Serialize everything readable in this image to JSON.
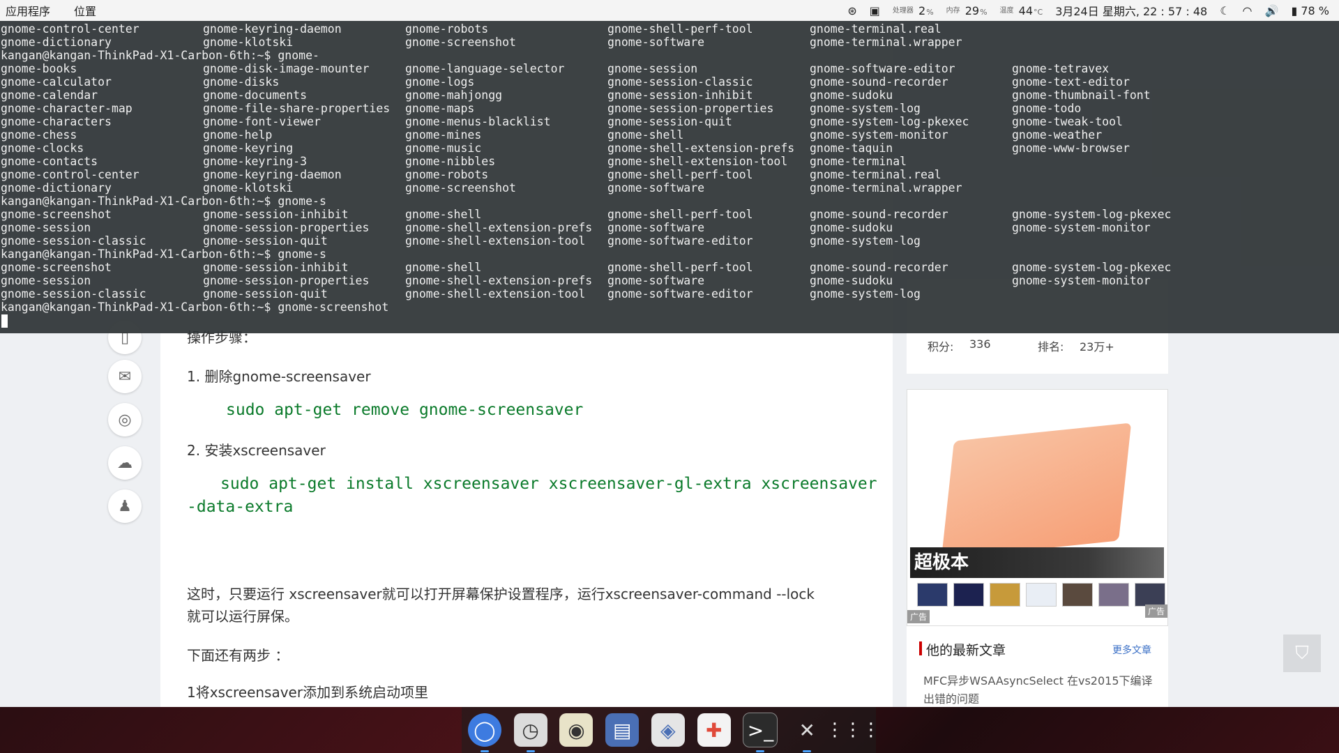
{
  "topbar": {
    "apps_label": "应用程序",
    "places_label": "位置",
    "cpu_label": "处理器",
    "cpu_value": "2",
    "cpu_unit": "%",
    "mem_label": "内存",
    "mem_value": "29",
    "mem_unit": "%",
    "temp_label": "温度",
    "temp_value": "44",
    "temp_unit": "°C",
    "datetime": "3月24日 星期六, 22 : 57 : 48",
    "battery": "78 %",
    "icons": [
      "accessibility-icon",
      "system-monitor-icon",
      "night-light-icon",
      "wifi-icon",
      "volume-icon",
      "battery-icon"
    ]
  },
  "terminal": {
    "lines": [
      [
        "gnome-control-center",
        "gnome-keyring-daemon",
        "gnome-robots",
        "gnome-shell-perf-tool",
        "gnome-terminal.real",
        ""
      ],
      [
        "gnome-dictionary",
        "gnome-klotski",
        "gnome-screenshot",
        "gnome-software",
        "gnome-terminal.wrapper",
        ""
      ],
      [
        "kangan@kangan-ThinkPad-X1-Carbon-6th:~$ gnome-",
        "",
        "",
        "",
        "",
        ""
      ],
      [
        "gnome-books",
        "gnome-disk-image-mounter",
        "gnome-language-selector",
        "gnome-session",
        "gnome-software-editor",
        "gnome-tetravex"
      ],
      [
        "gnome-calculator",
        "gnome-disks",
        "gnome-logs",
        "gnome-session-classic",
        "gnome-sound-recorder",
        "gnome-text-editor"
      ],
      [
        "gnome-calendar",
        "gnome-documents",
        "gnome-mahjongg",
        "gnome-session-inhibit",
        "gnome-sudoku",
        "gnome-thumbnail-font"
      ],
      [
        "gnome-character-map",
        "gnome-file-share-properties",
        "gnome-maps",
        "gnome-session-properties",
        "gnome-system-log",
        "gnome-todo"
      ],
      [
        "gnome-characters",
        "gnome-font-viewer",
        "gnome-menus-blacklist",
        "gnome-session-quit",
        "gnome-system-log-pkexec",
        "gnome-tweak-tool"
      ],
      [
        "gnome-chess",
        "gnome-help",
        "gnome-mines",
        "gnome-shell",
        "gnome-system-monitor",
        "gnome-weather"
      ],
      [
        "gnome-clocks",
        "gnome-keyring",
        "gnome-music",
        "gnome-shell-extension-prefs",
        "gnome-taquin",
        "gnome-www-browser"
      ],
      [
        "gnome-contacts",
        "gnome-keyring-3",
        "gnome-nibbles",
        "gnome-shell-extension-tool",
        "gnome-terminal",
        ""
      ],
      [
        "gnome-control-center",
        "gnome-keyring-daemon",
        "gnome-robots",
        "gnome-shell-perf-tool",
        "gnome-terminal.real",
        ""
      ],
      [
        "gnome-dictionary",
        "gnome-klotski",
        "gnome-screenshot",
        "gnome-software",
        "gnome-terminal.wrapper",
        ""
      ],
      [
        "kangan@kangan-ThinkPad-X1-Carbon-6th:~$ gnome-s",
        "",
        "",
        "",
        "",
        ""
      ],
      [
        "gnome-screenshot",
        "gnome-session-inhibit",
        "gnome-shell",
        "gnome-shell-perf-tool",
        "gnome-sound-recorder",
        "gnome-system-log-pkexec"
      ],
      [
        "gnome-session",
        "gnome-session-properties",
        "gnome-shell-extension-prefs",
        "gnome-software",
        "gnome-sudoku",
        "gnome-system-monitor"
      ],
      [
        "gnome-session-classic",
        "gnome-session-quit",
        "gnome-shell-extension-tool",
        "gnome-software-editor",
        "gnome-system-log",
        ""
      ],
      [
        "kangan@kangan-ThinkPad-X1-Carbon-6th:~$ gnome-s",
        "",
        "",
        "",
        "",
        ""
      ],
      [
        "gnome-screenshot",
        "gnome-session-inhibit",
        "gnome-shell",
        "gnome-shell-perf-tool",
        "gnome-sound-recorder",
        "gnome-system-log-pkexec"
      ],
      [
        "gnome-session",
        "gnome-session-properties",
        "gnome-shell-extension-prefs",
        "gnome-software",
        "gnome-sudoku",
        "gnome-system-monitor"
      ],
      [
        "gnome-session-classic",
        "gnome-session-quit",
        "gnome-shell-extension-tool",
        "gnome-software-editor",
        "gnome-system-log",
        ""
      ],
      [
        "kangan@kangan-ThinkPad-X1-Carbon-6th:~$ gnome-screenshot",
        "",
        "",
        "",
        "",
        ""
      ]
    ]
  },
  "article": {
    "step1": "1.   删除gnome-screensaver",
    "cmd1": "sudo apt-get remove gnome-screensaver",
    "step2": "2. 安装xscreensaver",
    "cmd2a": "sudo apt-get install xscreensaver xscreensaver-gl-extra xscreensaver",
    "cmd2b": "-data-extra",
    "para1a": "这时，只要运行 xscreensaver就可以打开屏幕保护设置程序，运行xscreensaver-command --lock",
    "para1b": "就可以运行屏保。",
    "para2": "下面还有两步 ：",
    "para3": "1将xscreensaver添加到系统启动项里",
    "steps_heading": "操作步骤："
  },
  "sidebar": {
    "icons": [
      "bookmark-icon",
      "comment-icon",
      "weibo-icon",
      "wechat-icon",
      "qq-icon"
    ]
  },
  "profile": {
    "points_label": "积分:",
    "points_value": "336",
    "rank_label": "排名:",
    "rank_value": "23万+"
  },
  "ad": {
    "banner": "超极本",
    "tag": "广告"
  },
  "recent": {
    "title": "他的最新文章",
    "more": "更多文章",
    "item": "MFC异步WSAAsyncSelect 在vs2015下编译出错的问题"
  },
  "dock": {
    "apps": [
      "chrome-icon",
      "timeshift-icon",
      "rhythmbox-icon",
      "files-icon",
      "software-center-icon",
      "help-icon",
      "terminal-icon",
      "tools-icon",
      "app-grid-icon"
    ]
  }
}
